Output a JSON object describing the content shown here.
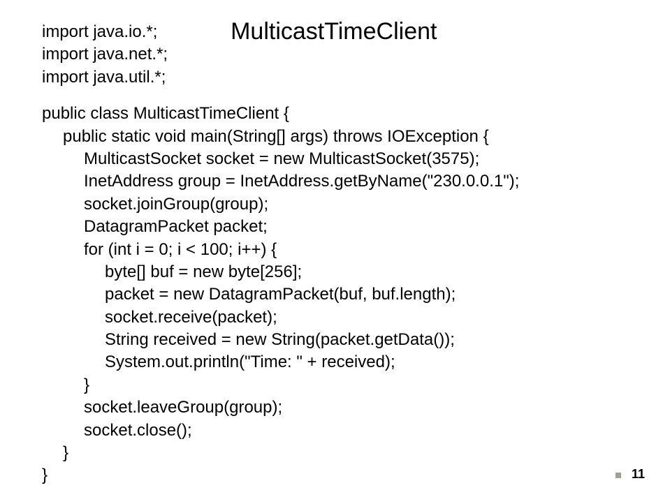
{
  "title": "MulticastTimeClient",
  "imports": {
    "l1": "import java.io.*;",
    "l2": "import java.net.*;",
    "l3": "import java.util.*;"
  },
  "code": {
    "c1": "public class MulticastTimeClient {",
    "c2": "public static void main(String[] args) throws IOException {",
    "c3": "MulticastSocket socket = new MulticastSocket(3575);",
    "c4": "InetAddress group = InetAddress.getByName(\"230.0.0.1\");",
    "c5": "socket.joinGroup(group);",
    "c6": "DatagramPacket packet;",
    "c7": "for (int i = 0; i < 100; i++) {",
    "c8": "byte[] buf = new byte[256];",
    "c9": "packet = new DatagramPacket(buf, buf.length);",
    "c10": "socket.receive(packet);",
    "c11": "String received = new String(packet.getData());",
    "c12": "System.out.println(\"Time: \" + received);",
    "c13": "}",
    "c14": "socket.leaveGroup(group);",
    "c15": "socket.close();",
    "c16": "}",
    "c17": "}"
  },
  "page_number": "11"
}
